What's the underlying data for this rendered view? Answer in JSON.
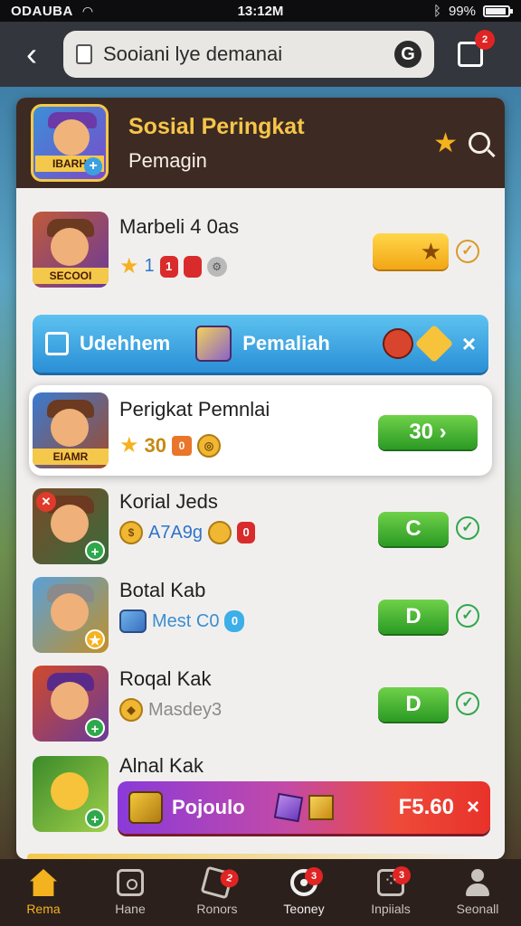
{
  "status_bar": {
    "carrier": "ODAUBA",
    "time": "13:12M",
    "battery_text": "99%",
    "battery_level": 0.86
  },
  "browser": {
    "url_text": "Sooiani lye demanai",
    "refresh_glyph": "G",
    "share_badge": "2"
  },
  "header": {
    "icon_label": "IBARH",
    "title": "Sosial Peringkat",
    "subtitle": "Pemagin"
  },
  "rows": [
    {
      "name": "Marbeli 4 0as",
      "avatar_tag": "SECOOI",
      "stats": [
        "1",
        "1"
      ]
    },
    {
      "name": "Perigkat Pemnlai",
      "avatar_tag": "EIAMR",
      "stats_star_text": "30",
      "button_label": "30 ›"
    },
    {
      "name": "Korial Jeds",
      "stat_text": "A7A9g",
      "red_chip": "0",
      "button_label": "C"
    },
    {
      "name": "Botal Kab",
      "stat_text": "Mest C0",
      "blue_chip": "0",
      "button_label": "D"
    },
    {
      "name": "Roqal Kak",
      "stat_text": "Masdey3",
      "button_label": "D"
    },
    {
      "name": "Alnal Kak"
    }
  ],
  "banner": {
    "left_text": "Udehhem",
    "right_text": "Pemaliah",
    "close": "×"
  },
  "promo": {
    "label": "Pojoulo",
    "price": "F5.60",
    "close": "×"
  },
  "bottom_nav": [
    {
      "label": "Rema",
      "badge": ""
    },
    {
      "label": "Hane",
      "badge": ""
    },
    {
      "label": "Ronors",
      "badge": "2"
    },
    {
      "label": "Teoney",
      "badge": "3"
    },
    {
      "label": "Inpiials",
      "badge": "3"
    },
    {
      "label": "Seonall",
      "badge": ""
    }
  ],
  "colors": {
    "header_bg": "#3d2a22",
    "title_gold": "#f6c54a",
    "green_button": "#2b9a24",
    "banner_blue": "#2a8fd6",
    "nav_active": "#f4b21e"
  }
}
